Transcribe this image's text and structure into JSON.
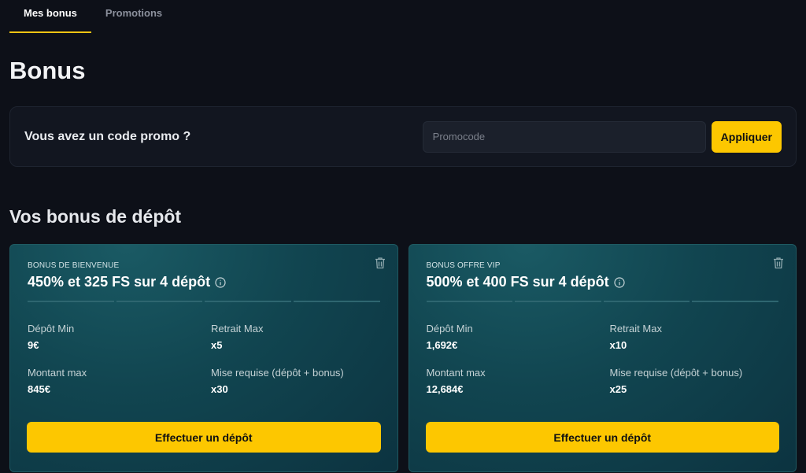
{
  "tabs": [
    {
      "label": "Mes bonus",
      "active": true
    },
    {
      "label": "Promotions",
      "active": false
    }
  ],
  "page_title": "Bonus",
  "promo": {
    "label": "Vous avez un code promo ?",
    "placeholder": "Promocode",
    "value": "",
    "apply_label": "Appliquer"
  },
  "section_title": "Vos bonus de dépôt",
  "cards": [
    {
      "tag": "BONUS DE BIENVENUE",
      "title": "450% et 325 FS sur 4 dépôt",
      "steps": 4,
      "fields": [
        {
          "label": "Dépôt Min",
          "value": "9€"
        },
        {
          "label": "Retrait Max",
          "value": "x5"
        },
        {
          "label": "Montant max",
          "value": "845€"
        },
        {
          "label": "Mise requise (dépôt + bonus)",
          "value": "x30"
        }
      ],
      "button_label": "Effectuer un dépôt"
    },
    {
      "tag": "BONUS OFFRE VIP",
      "title": "500% et 400 FS sur 4 dépôt",
      "steps": 4,
      "fields": [
        {
          "label": "Dépôt Min",
          "value": "1,692€"
        },
        {
          "label": "Retrait Max",
          "value": "x10"
        },
        {
          "label": "Montant max",
          "value": "12,684€"
        },
        {
          "label": "Mise requise (dépôt + bonus)",
          "value": "x25"
        }
      ],
      "button_label": "Effectuer un dépôt"
    }
  ],
  "icons": {
    "card_info": "info-icon",
    "card_delete": "trash-icon"
  },
  "colors": {
    "accent": "#fdc700",
    "background": "#0d1018",
    "card_teal": "#114550"
  }
}
